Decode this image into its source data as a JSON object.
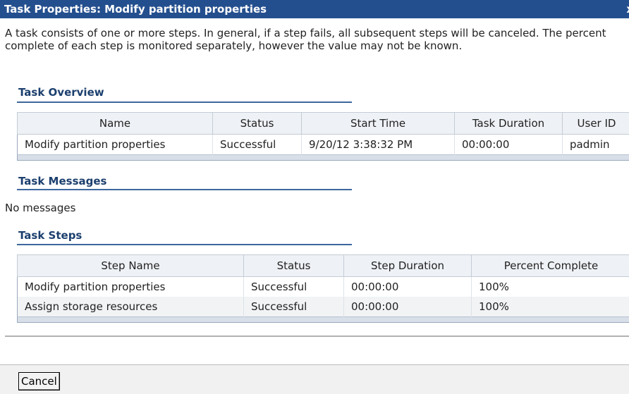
{
  "window": {
    "title": "Task Properties: Modify partition properties",
    "close_glyph": "x"
  },
  "intro": "A task consists of one or more steps. In general, if a step fails, all subsequent steps will be canceled. The percent complete of each step is monitored separately, however the value may not be known.",
  "overview": {
    "heading": "Task Overview",
    "columns": [
      "Name",
      "Status",
      "Start Time",
      "Task Duration",
      "User ID"
    ],
    "rows": [
      [
        "Modify partition properties",
        "Successful",
        "9/20/12 3:38:32 PM",
        "00:00:00",
        "padmin"
      ]
    ]
  },
  "messages": {
    "heading": "Task Messages",
    "empty_text": "No messages"
  },
  "steps": {
    "heading": "Task Steps",
    "columns": [
      "Step Name",
      "Status",
      "Step Duration",
      "Percent Complete"
    ],
    "rows": [
      [
        "Modify partition properties",
        "Successful",
        "00:00:00",
        "100%"
      ],
      [
        "Assign storage resources",
        "Successful",
        "00:00:00",
        "100%"
      ]
    ]
  },
  "footer": {
    "cancel_label": "Cancel"
  }
}
